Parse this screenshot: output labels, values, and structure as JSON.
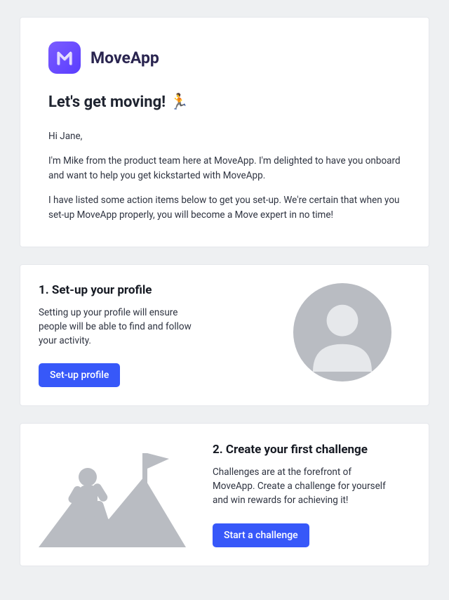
{
  "brand": {
    "name": "MoveApp"
  },
  "headline": "Let's get moving! 🏃",
  "intro": {
    "greeting": "Hi Jane,",
    "p1": "I'm Mike from the product team here at MoveApp. I'm delighted to have you onboard and want to help you get kickstarted with MoveApp.",
    "p2": "I have listed some action items below to get you set-up. We're certain that when you set-up MoveApp properly, you will become a Move expert in no time!"
  },
  "steps": [
    {
      "title": "1. Set-up your profile",
      "desc": "Setting up your profile will ensure people will be able to find and follow your activity.",
      "cta": "Set-up profile"
    },
    {
      "title": "2. Create your first challenge",
      "desc": "Challenges are at the forefront of MoveApp. Create a challenge for yourself and win rewards for achieving it!",
      "cta": "Start a challenge"
    }
  ],
  "colors": {
    "primary": "#3758f9",
    "brand_gradient_from": "#7b5cff",
    "brand_gradient_to": "#5a3dff",
    "page_bg": "#eef0f2",
    "card_border": "#e5e7eb"
  }
}
